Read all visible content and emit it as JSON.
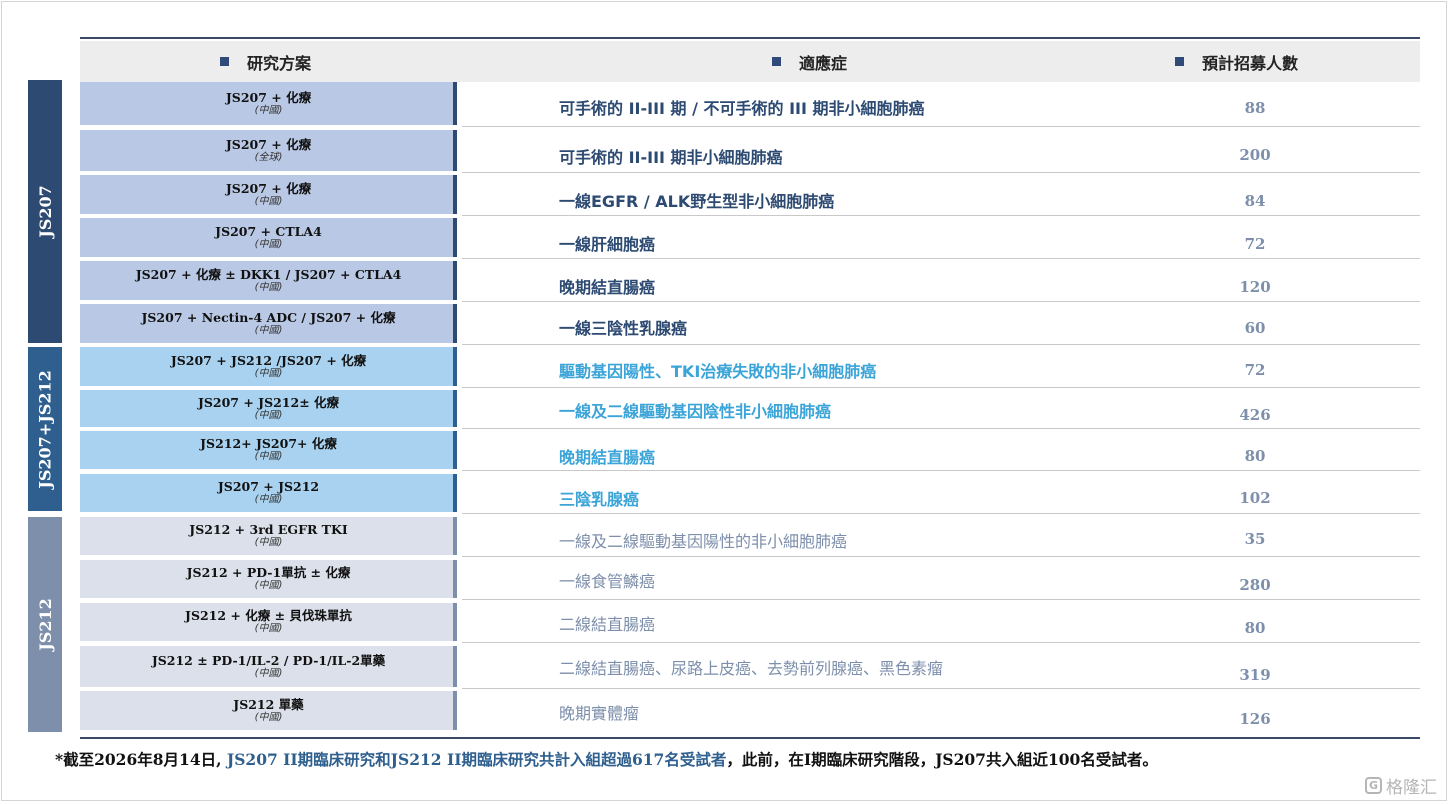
{
  "header": {
    "scheme": "研究方案",
    "indication": "適應症",
    "enrollment": "預計招募人數"
  },
  "groups": [
    "JS207",
    "JS207+JS212",
    "JS212"
  ],
  "rows": [
    {
      "main": "JS207 + 化療",
      "sub": "(中國)",
      "ind": "可手術的 II-III 期 / 不可手術的 III 期非小細胞肺癌",
      "n": "88"
    },
    {
      "main": "JS207 + 化療",
      "sub": "(全球)",
      "ind": "可手術的 II-III 期非小細胞肺癌",
      "n": "200"
    },
    {
      "main": "JS207 + 化療",
      "sub": "(中國)",
      "ind": "一線EGFR / ALK野生型非小細胞肺癌",
      "n": "84"
    },
    {
      "main": "JS207 + CTLA4",
      "sub": "(中國)",
      "ind": "一線肝細胞癌",
      "n": "72"
    },
    {
      "main": "JS207 + 化療 ± DKK1 / JS207 + CTLA4",
      "sub": "(中國)",
      "ind": "晚期結直腸癌",
      "n": "120"
    },
    {
      "main": "JS207 + Nectin-4 ADC / JS207 + 化療",
      "sub": "(中國)",
      "ind": "一線三陰性乳腺癌",
      "n": "60"
    },
    {
      "main": "JS207 + JS212 /JS207 + 化療",
      "sub": "(中國)",
      "ind": "驅動基因陽性、TKI治療失敗的非小細胞肺癌",
      "n": "72"
    },
    {
      "main": "JS207 + JS212± 化療",
      "sub": "(中國)",
      "ind": "一線及二線驅動基因陰性非小細胞肺癌",
      "n": "426"
    },
    {
      "main": "JS212+ JS207+ 化療",
      "sub": "(中國)",
      "ind": "晚期結直腸癌",
      "n": "80"
    },
    {
      "main": "JS207 + JS212",
      "sub": "(中國)",
      "ind": "三陰乳腺癌",
      "n": "102"
    },
    {
      "main": "JS212 + 3rd EGFR TKI",
      "sub": "(中國)",
      "ind": "一線及二線驅動基因陽性的非小細胞肺癌",
      "n": "35"
    },
    {
      "main": "JS212 + PD-1單抗 ± 化療",
      "sub": "(中國)",
      "ind": "一線食管鱗癌",
      "n": "280"
    },
    {
      "main": "JS212 + 化療 ± 貝伐珠單抗",
      "sub": "(中國)",
      "ind": "二線結直腸癌",
      "n": "80"
    },
    {
      "main": "JS212 ± PD-1/IL-2 / PD-1/IL-2單藥",
      "sub": "(中國)",
      "ind": "二線結直腸癌、尿路上皮癌、去勢前列腺癌、黑色素瘤",
      "n": "319"
    },
    {
      "main": "JS212 單藥",
      "sub": "(中國)",
      "ind": "晚期實體瘤",
      "n": "126"
    }
  ],
  "footnote": {
    "p1": "*截至2026年8月14日, ",
    "p2": "JS207 II期臨床研究和JS212 II期臨床研究共計入組超過617名受試者",
    "p3": "，此前，在I期臨床研究階段，JS207共入組近100名受試者。"
  },
  "logo": {
    "glyph": "G",
    "text": "格隆汇"
  }
}
